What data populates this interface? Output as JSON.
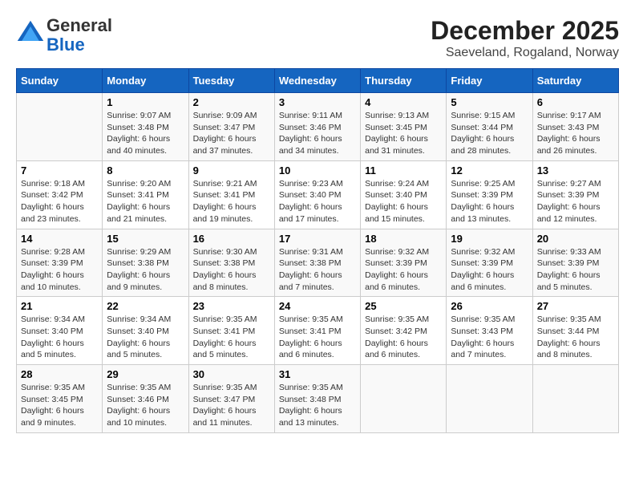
{
  "logo": {
    "general": "General",
    "blue": "Blue"
  },
  "title": "December 2025",
  "subtitle": "Saeveland, Rogaland, Norway",
  "weekdays": [
    "Sunday",
    "Monday",
    "Tuesday",
    "Wednesday",
    "Thursday",
    "Friday",
    "Saturday"
  ],
  "weeks": [
    [
      {
        "day": "",
        "sunrise": "",
        "sunset": "",
        "daylight": ""
      },
      {
        "day": "1",
        "sunrise": "Sunrise: 9:07 AM",
        "sunset": "Sunset: 3:48 PM",
        "daylight": "Daylight: 6 hours and 40 minutes."
      },
      {
        "day": "2",
        "sunrise": "Sunrise: 9:09 AM",
        "sunset": "Sunset: 3:47 PM",
        "daylight": "Daylight: 6 hours and 37 minutes."
      },
      {
        "day": "3",
        "sunrise": "Sunrise: 9:11 AM",
        "sunset": "Sunset: 3:46 PM",
        "daylight": "Daylight: 6 hours and 34 minutes."
      },
      {
        "day": "4",
        "sunrise": "Sunrise: 9:13 AM",
        "sunset": "Sunset: 3:45 PM",
        "daylight": "Daylight: 6 hours and 31 minutes."
      },
      {
        "day": "5",
        "sunrise": "Sunrise: 9:15 AM",
        "sunset": "Sunset: 3:44 PM",
        "daylight": "Daylight: 6 hours and 28 minutes."
      },
      {
        "day": "6",
        "sunrise": "Sunrise: 9:17 AM",
        "sunset": "Sunset: 3:43 PM",
        "daylight": "Daylight: 6 hours and 26 minutes."
      }
    ],
    [
      {
        "day": "7",
        "sunrise": "Sunrise: 9:18 AM",
        "sunset": "Sunset: 3:42 PM",
        "daylight": "Daylight: 6 hours and 23 minutes."
      },
      {
        "day": "8",
        "sunrise": "Sunrise: 9:20 AM",
        "sunset": "Sunset: 3:41 PM",
        "daylight": "Daylight: 6 hours and 21 minutes."
      },
      {
        "day": "9",
        "sunrise": "Sunrise: 9:21 AM",
        "sunset": "Sunset: 3:41 PM",
        "daylight": "Daylight: 6 hours and 19 minutes."
      },
      {
        "day": "10",
        "sunrise": "Sunrise: 9:23 AM",
        "sunset": "Sunset: 3:40 PM",
        "daylight": "Daylight: 6 hours and 17 minutes."
      },
      {
        "day": "11",
        "sunrise": "Sunrise: 9:24 AM",
        "sunset": "Sunset: 3:40 PM",
        "daylight": "Daylight: 6 hours and 15 minutes."
      },
      {
        "day": "12",
        "sunrise": "Sunrise: 9:25 AM",
        "sunset": "Sunset: 3:39 PM",
        "daylight": "Daylight: 6 hours and 13 minutes."
      },
      {
        "day": "13",
        "sunrise": "Sunrise: 9:27 AM",
        "sunset": "Sunset: 3:39 PM",
        "daylight": "Daylight: 6 hours and 12 minutes."
      }
    ],
    [
      {
        "day": "14",
        "sunrise": "Sunrise: 9:28 AM",
        "sunset": "Sunset: 3:39 PM",
        "daylight": "Daylight: 6 hours and 10 minutes."
      },
      {
        "day": "15",
        "sunrise": "Sunrise: 9:29 AM",
        "sunset": "Sunset: 3:38 PM",
        "daylight": "Daylight: 6 hours and 9 minutes."
      },
      {
        "day": "16",
        "sunrise": "Sunrise: 9:30 AM",
        "sunset": "Sunset: 3:38 PM",
        "daylight": "Daylight: 6 hours and 8 minutes."
      },
      {
        "day": "17",
        "sunrise": "Sunrise: 9:31 AM",
        "sunset": "Sunset: 3:38 PM",
        "daylight": "Daylight: 6 hours and 7 minutes."
      },
      {
        "day": "18",
        "sunrise": "Sunrise: 9:32 AM",
        "sunset": "Sunset: 3:39 PM",
        "daylight": "Daylight: 6 hours and 6 minutes."
      },
      {
        "day": "19",
        "sunrise": "Sunrise: 9:32 AM",
        "sunset": "Sunset: 3:39 PM",
        "daylight": "Daylight: 6 hours and 6 minutes."
      },
      {
        "day": "20",
        "sunrise": "Sunrise: 9:33 AM",
        "sunset": "Sunset: 3:39 PM",
        "daylight": "Daylight: 6 hours and 5 minutes."
      }
    ],
    [
      {
        "day": "21",
        "sunrise": "Sunrise: 9:34 AM",
        "sunset": "Sunset: 3:40 PM",
        "daylight": "Daylight: 6 hours and 5 minutes."
      },
      {
        "day": "22",
        "sunrise": "Sunrise: 9:34 AM",
        "sunset": "Sunset: 3:40 PM",
        "daylight": "Daylight: 6 hours and 5 minutes."
      },
      {
        "day": "23",
        "sunrise": "Sunrise: 9:35 AM",
        "sunset": "Sunset: 3:41 PM",
        "daylight": "Daylight: 6 hours and 5 minutes."
      },
      {
        "day": "24",
        "sunrise": "Sunrise: 9:35 AM",
        "sunset": "Sunset: 3:41 PM",
        "daylight": "Daylight: 6 hours and 6 minutes."
      },
      {
        "day": "25",
        "sunrise": "Sunrise: 9:35 AM",
        "sunset": "Sunset: 3:42 PM",
        "daylight": "Daylight: 6 hours and 6 minutes."
      },
      {
        "day": "26",
        "sunrise": "Sunrise: 9:35 AM",
        "sunset": "Sunset: 3:43 PM",
        "daylight": "Daylight: 6 hours and 7 minutes."
      },
      {
        "day": "27",
        "sunrise": "Sunrise: 9:35 AM",
        "sunset": "Sunset: 3:44 PM",
        "daylight": "Daylight: 6 hours and 8 minutes."
      }
    ],
    [
      {
        "day": "28",
        "sunrise": "Sunrise: 9:35 AM",
        "sunset": "Sunset: 3:45 PM",
        "daylight": "Daylight: 6 hours and 9 minutes."
      },
      {
        "day": "29",
        "sunrise": "Sunrise: 9:35 AM",
        "sunset": "Sunset: 3:46 PM",
        "daylight": "Daylight: 6 hours and 10 minutes."
      },
      {
        "day": "30",
        "sunrise": "Sunrise: 9:35 AM",
        "sunset": "Sunset: 3:47 PM",
        "daylight": "Daylight: 6 hours and 11 minutes."
      },
      {
        "day": "31",
        "sunrise": "Sunrise: 9:35 AM",
        "sunset": "Sunset: 3:48 PM",
        "daylight": "Daylight: 6 hours and 13 minutes."
      },
      {
        "day": "",
        "sunrise": "",
        "sunset": "",
        "daylight": ""
      },
      {
        "day": "",
        "sunrise": "",
        "sunset": "",
        "daylight": ""
      },
      {
        "day": "",
        "sunrise": "",
        "sunset": "",
        "daylight": ""
      }
    ]
  ]
}
